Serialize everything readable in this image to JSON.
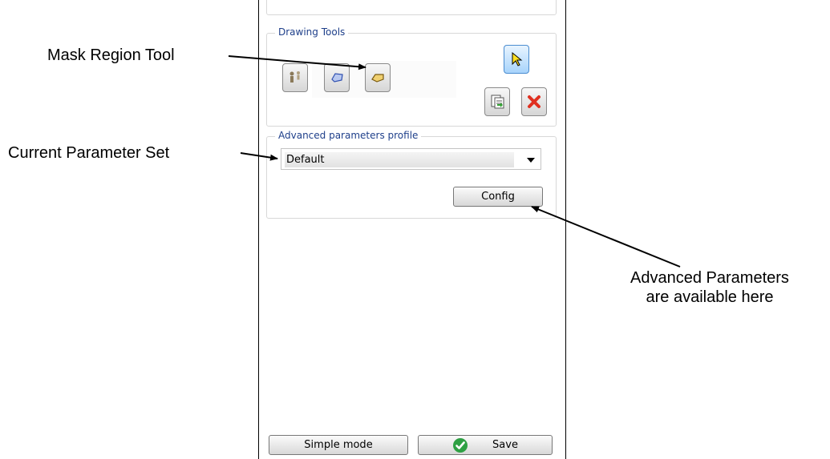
{
  "annotations": {
    "mask_region_tool": "Mask Region Tool",
    "current_parameter_set": "Current Parameter Set",
    "advanced_parameters_line1": "Advanced Parameters",
    "advanced_parameters_line2": "are available here"
  },
  "panel": {
    "drawing_tools": {
      "title": "Drawing Tools",
      "tools": [
        {
          "icon": "person-icon"
        },
        {
          "icon": "region-icon"
        },
        {
          "icon": "mask-region-icon"
        },
        {
          "icon": "pointer-icon"
        },
        {
          "icon": "copy-icon"
        },
        {
          "icon": "delete-icon"
        }
      ]
    },
    "advanced_profile": {
      "title": "Advanced parameters profile",
      "selected_value": "Default",
      "config_label": "Config"
    },
    "footer": {
      "simple_mode_label": "Simple mode",
      "save_label": "Save"
    }
  },
  "colors": {
    "group_title": "#1e3f8a",
    "selected_tool": "#a8d4fb",
    "save_check": "#2ea043",
    "delete_x": "#e03020"
  }
}
